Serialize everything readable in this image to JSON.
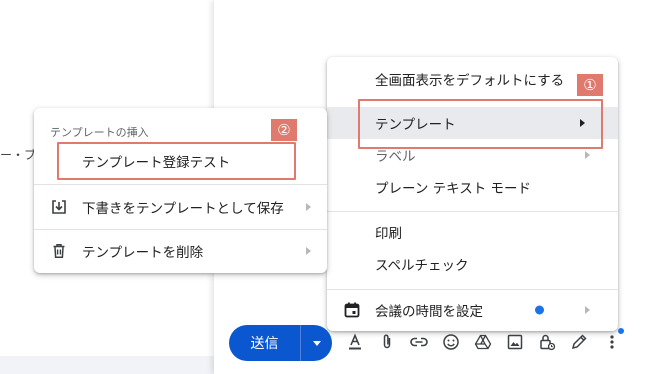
{
  "background": {
    "left_cut_text": "ー・ブ"
  },
  "more_options_menu": {
    "items": [
      {
        "label": "全画面表示をデフォルトにする"
      },
      {
        "label": "テンプレート"
      },
      {
        "label": "ラベル"
      },
      {
        "label": "プレーン テキスト モード"
      },
      {
        "label": "印刷"
      },
      {
        "label": "スペルチェック"
      },
      {
        "label": "会議の時間を設定"
      }
    ],
    "callout_badge": "①"
  },
  "templates_menu": {
    "section_title": "テンプレートの挿入",
    "template_item": "テンプレート登録テスト",
    "save_draft_label": "下書きをテンプレートとして保存",
    "delete_label": "テンプレートを削除",
    "callout_badge": "②"
  },
  "toolbar": {
    "send_label": "送信",
    "icons": [
      "format-text-icon",
      "attach-icon",
      "link-icon",
      "emoji-icon",
      "drive-icon",
      "photo-icon",
      "lock-clock-icon",
      "pen-icon",
      "more-vert-icon"
    ]
  },
  "colors": {
    "accent": "#0b57d0",
    "callout": "#e07a6e",
    "notification_dot": "#1a73e8"
  }
}
